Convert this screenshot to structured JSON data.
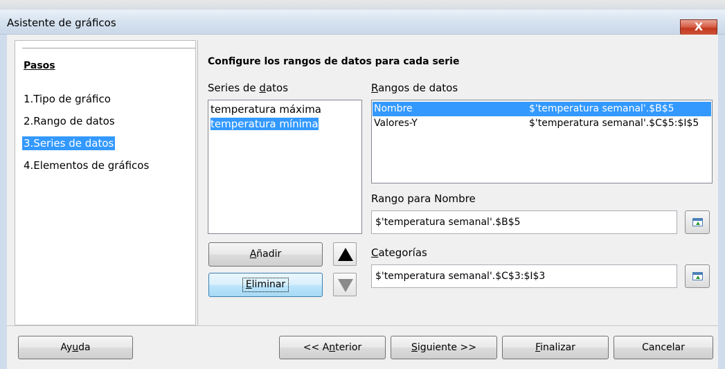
{
  "window": {
    "title": "Asistente de gráficos",
    "close_glyph": "X"
  },
  "steps": {
    "heading": "Pasos",
    "items": [
      {
        "label": "1.Tipo de gráfico",
        "selected": false
      },
      {
        "label": "2.Rango de datos",
        "selected": false
      },
      {
        "label": "3.Series de datos",
        "selected": true
      },
      {
        "label": "4.Elementos de gráficos",
        "selected": false
      }
    ]
  },
  "main": {
    "heading": "Configure los rangos de datos para cada serie",
    "series": {
      "label_pre": "Series de ",
      "label_u": "d",
      "label_post": "atos",
      "items": [
        {
          "label": "temperatura máxima",
          "selected": false
        },
        {
          "label": "temperatura mínima",
          "selected": true
        }
      ]
    },
    "ranges": {
      "label_u": "R",
      "label_post": "angos de datos",
      "rows": [
        {
          "name": "Nombre",
          "value": "$'temperatura semanal'.$B$5",
          "selected": true
        },
        {
          "name": "Valores-Y",
          "value": "$'temperatura semanal'.$C$5:$I$5",
          "selected": false
        }
      ]
    },
    "range_for_name": {
      "label_pre": "Ran",
      "label_u": "g",
      "label_post": "o para Nombre",
      "value": "$'temperatura semanal'.$B$5"
    },
    "categories": {
      "label_u": "C",
      "label_post": "ategorías",
      "value": "$'temperatura semanal'.$C$3:$I$3"
    },
    "add_button": {
      "pre": "",
      "u": "A",
      "post": "ñadir"
    },
    "remove_button": {
      "pre": "",
      "u": "E",
      "post": "liminar"
    }
  },
  "footer": {
    "help": {
      "pre": "Ay",
      "u": "u",
      "post": "da"
    },
    "back": {
      "pre": "<< A",
      "u": "n",
      "post": "terior"
    },
    "next": {
      "pre": "",
      "u": "S",
      "post": "iguiente >>"
    },
    "finish": {
      "pre": "",
      "u": "F",
      "post": "inalizar"
    },
    "cancel": {
      "pre": "Cancelar",
      "u": "",
      "post": ""
    }
  },
  "colors": {
    "selection": "#3399ff",
    "close_button": "#c2391f"
  }
}
